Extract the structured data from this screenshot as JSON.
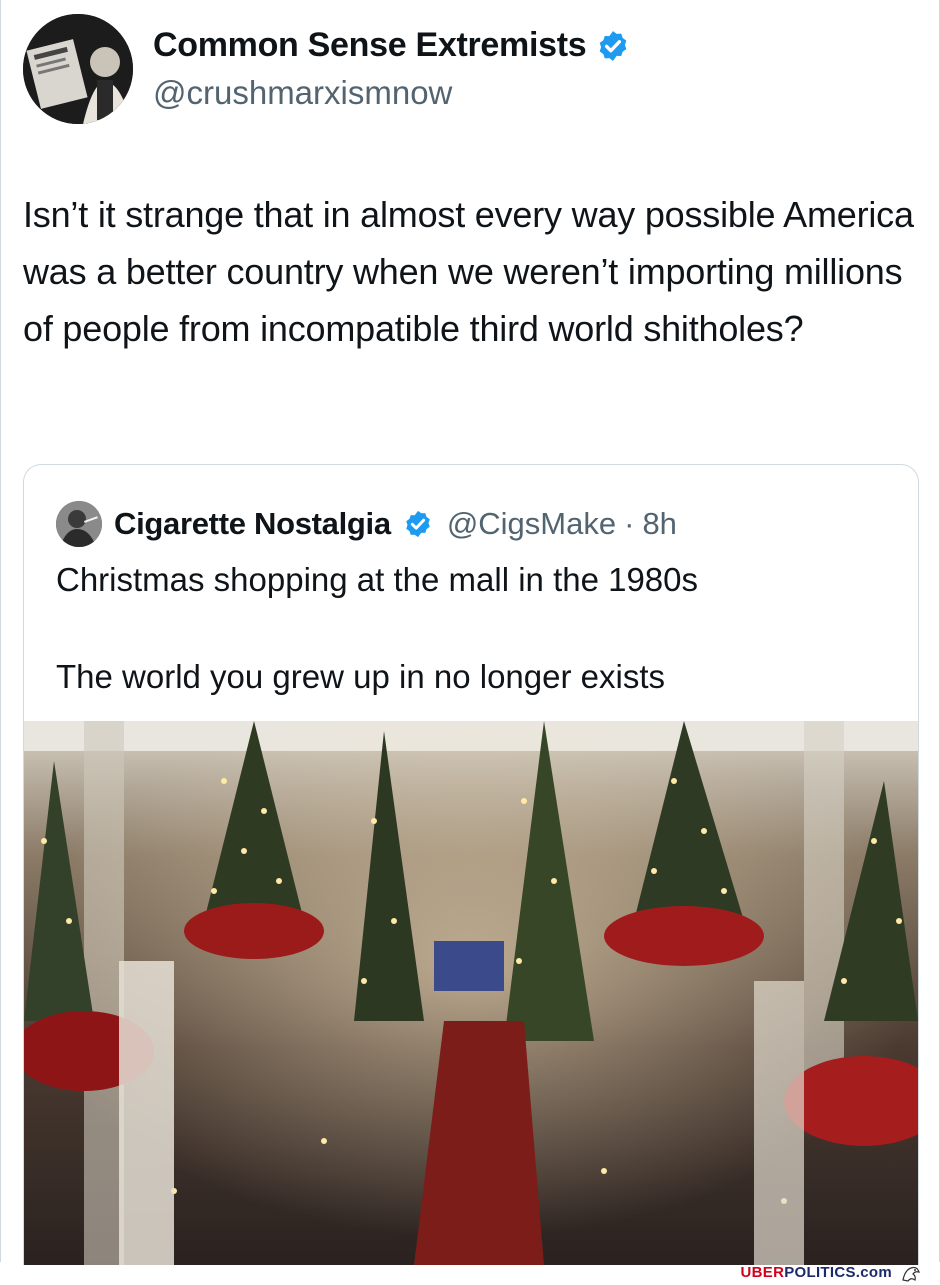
{
  "tweet": {
    "author_name": "Common Sense Extremists",
    "author_handle": "@crushmarxismnow",
    "verified_icon": "verified-badge-icon",
    "text": "Isn’t it strange that in almost every way possible America was a better country when we weren’t importing millions of people from incompatible third world shitholes?"
  },
  "quoted_tweet": {
    "author_name": "Cigarette Nostalgia",
    "author_handle": "@CigsMake",
    "separator": "·",
    "time": "8h",
    "line1": "Christmas shopping at the mall in the 1980s",
    "line2": "The world you grew up in no longer exists"
  },
  "footer": {
    "brand_part1": "UBER",
    "brand_part2": "POLITICS.com"
  },
  "colors": {
    "verified": "#1d9bf0",
    "handle_gray": "#536471",
    "brand_red": "#d0021b",
    "brand_blue": "#1a2a6c"
  }
}
